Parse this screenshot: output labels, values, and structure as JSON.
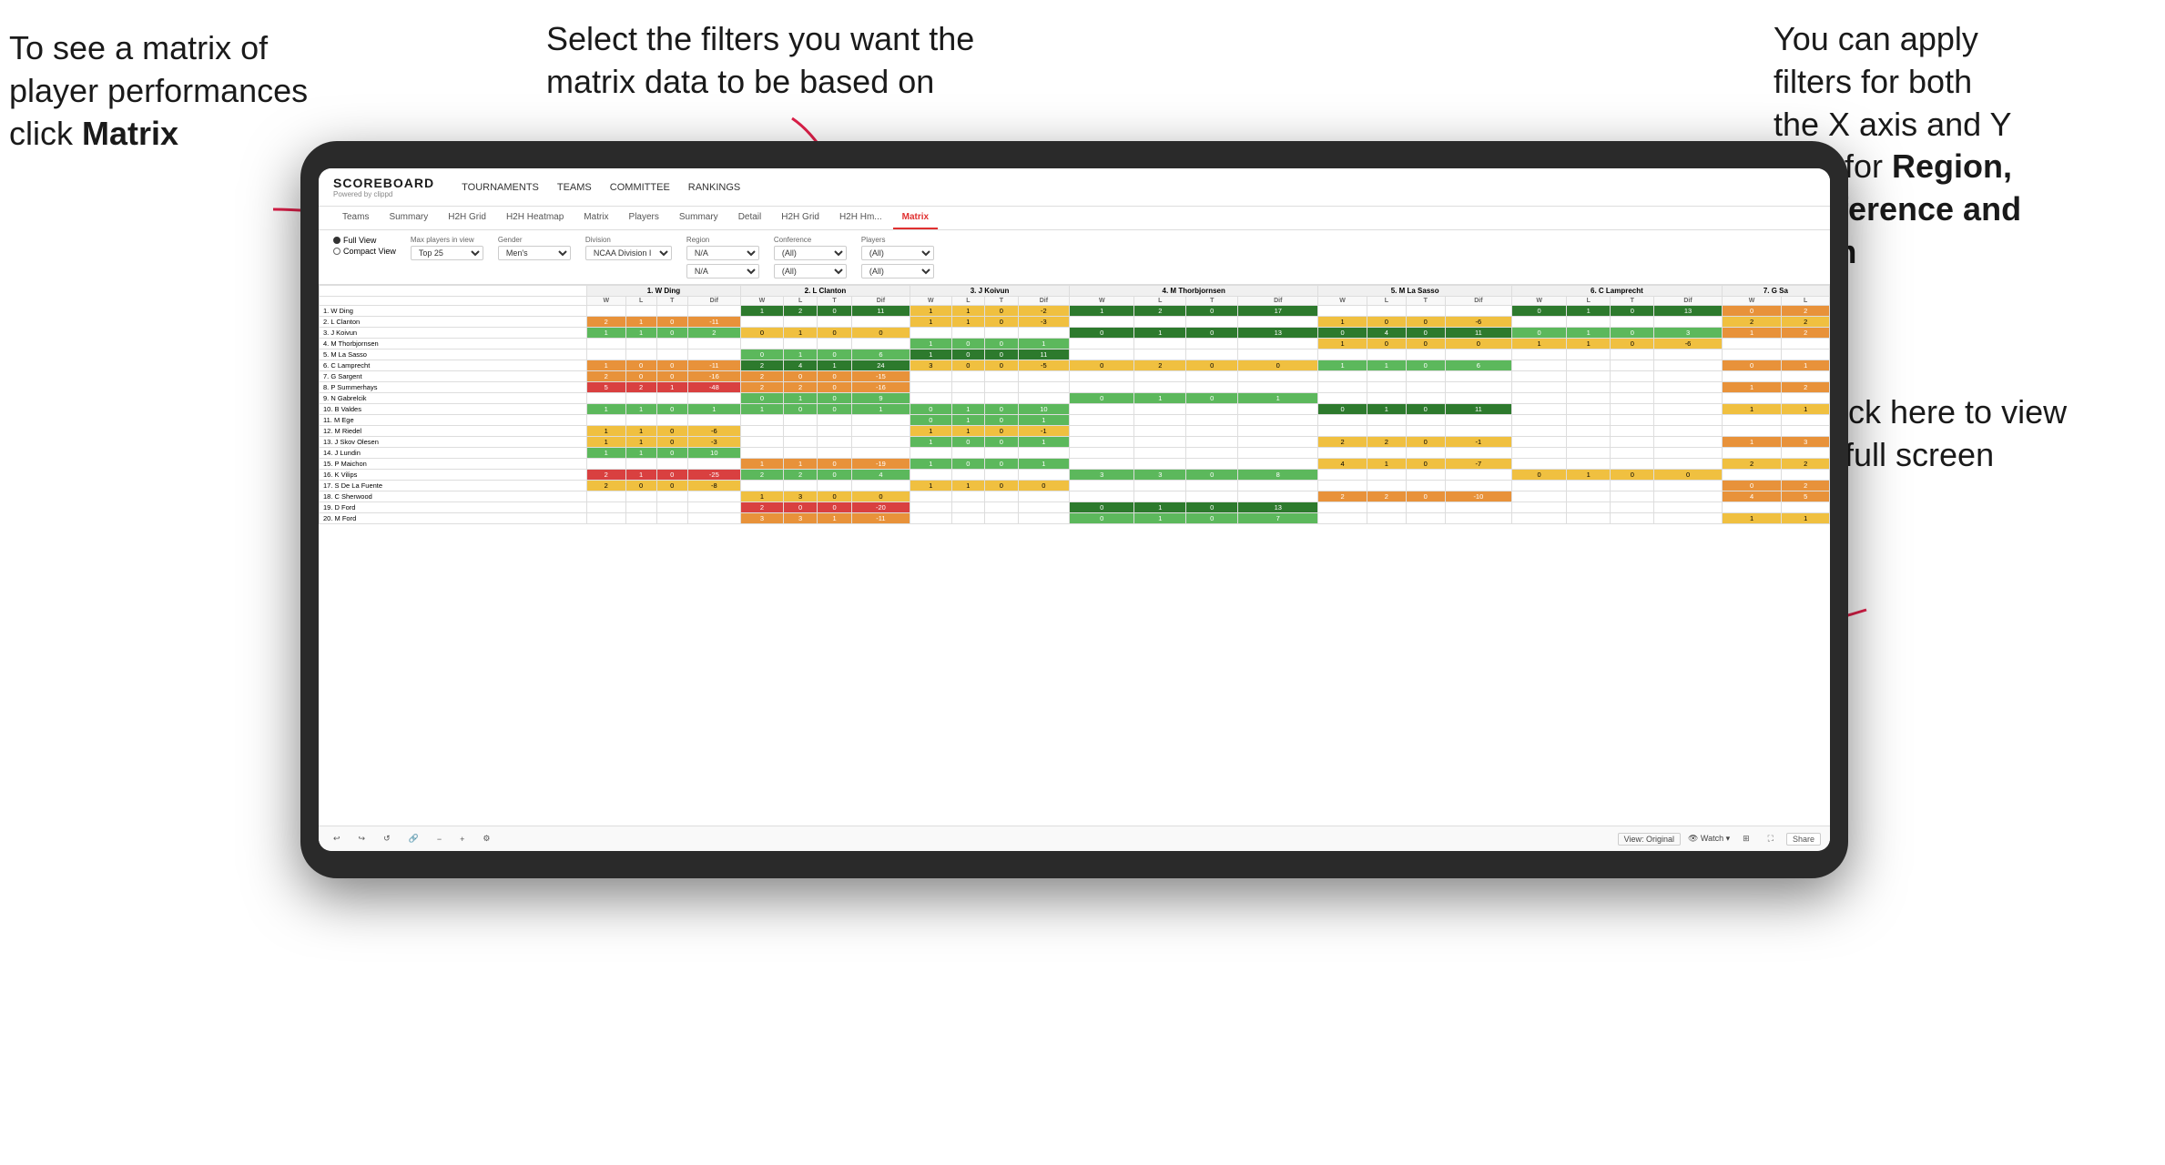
{
  "annotations": {
    "topleft": {
      "line1": "To see a matrix of",
      "line2": "player performances",
      "line3_plain": "click ",
      "line3_bold": "Matrix"
    },
    "topmid": {
      "text": "Select the filters you want the matrix data to be based on"
    },
    "topright": {
      "line1": "You  can apply",
      "line2": "filters for both",
      "line3": "the X axis and Y",
      "line4_plain": "Axis for ",
      "line4_bold": "Region,",
      "line5_bold": "Conference and",
      "line6_bold": "Team"
    },
    "bottomright": {
      "line1": "Click here to view",
      "line2": "in full screen"
    }
  },
  "app": {
    "logo": "SCOREBOARD",
    "logo_sub": "Powered by clippd",
    "nav": [
      "TOURNAMENTS",
      "TEAMS",
      "COMMITTEE",
      "RANKINGS"
    ],
    "subnav": [
      "Teams",
      "Summary",
      "H2H Grid",
      "H2H Heatmap",
      "Matrix",
      "Players",
      "Summary",
      "Detail",
      "H2H Grid",
      "H2H Hm...",
      "Matrix"
    ],
    "active_subnav": "Matrix",
    "filters": {
      "view_options": [
        "Full View",
        "Compact View"
      ],
      "active_view": "Full View",
      "max_players_label": "Max players in view",
      "max_players_value": "Top 25",
      "gender_label": "Gender",
      "gender_value": "Men's",
      "division_label": "Division",
      "division_value": "NCAA Division I",
      "region_label": "Region",
      "region_value1": "N/A",
      "region_value2": "N/A",
      "conference_label": "Conference",
      "conference_value1": "(All)",
      "conference_value2": "(All)",
      "players_label": "Players",
      "players_value1": "(All)",
      "players_value2": "(All)"
    },
    "column_headers": [
      "1. W Ding",
      "2. L Clanton",
      "3. J Koivun",
      "4. M Thorbjornsen",
      "5. M La Sasso",
      "6. C Lamprecht",
      "7. G Sa"
    ],
    "col_subheaders": [
      "W",
      "L",
      "T",
      "Dif"
    ],
    "row_players": [
      "1. W Ding",
      "2. L Clanton",
      "3. J Koivun",
      "4. M Thorbjornsen",
      "5. M La Sasso",
      "6. C Lamprecht",
      "7. G Sargent",
      "8. P Summerhays",
      "9. N Gabrelcik",
      "10. B Valdes",
      "11. M Ege",
      "12. M Riedel",
      "13. J Skov Olesen",
      "14. J Lundin",
      "15. P Maichon",
      "16. K Vilips",
      "17. S De La Fuente",
      "18. C Sherwood",
      "19. D Ford",
      "20. M Ford"
    ],
    "toolbar": {
      "view_label": "View: Original",
      "watch_label": "Watch ▾",
      "share_label": "Share"
    }
  }
}
